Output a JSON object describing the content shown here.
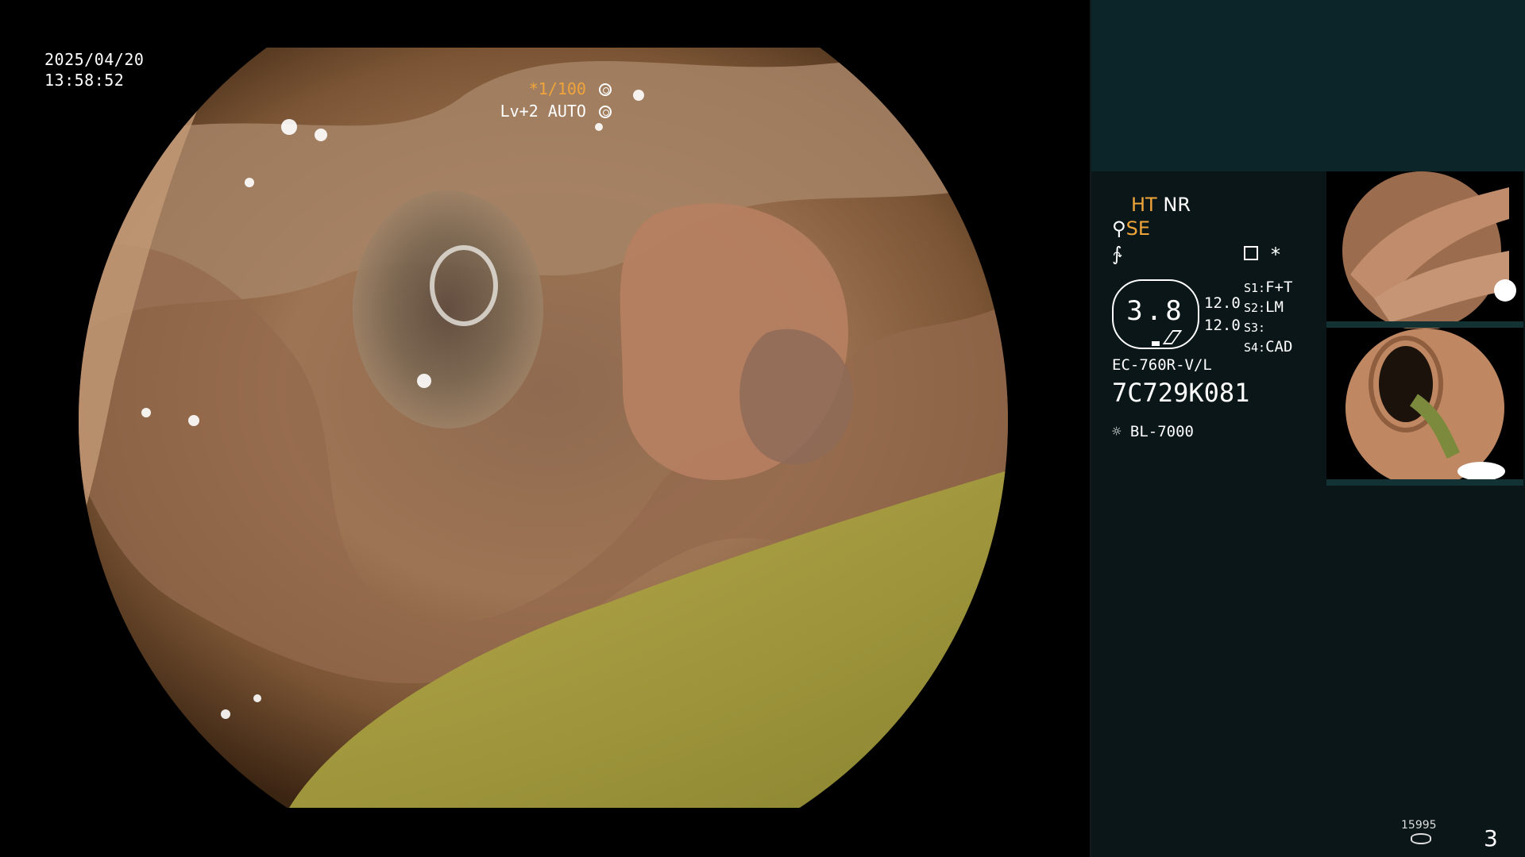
{
  "overlay": {
    "date": "2025/04/20",
    "time": "13:58:52",
    "shutter": "*1/100",
    "level": "Lv+2 AUTO"
  },
  "modes": {
    "ht": "HT",
    "nr": "NR",
    "se": "SE",
    "star": "*"
  },
  "zoom": {
    "value": "3.8",
    "right_values": [
      "12.0",
      "12.0"
    ]
  },
  "scope_settings": [
    {
      "key": "S1:",
      "value": "F+T"
    },
    {
      "key": "S2:",
      "value": "LM"
    },
    {
      "key": "S3:",
      "value": ""
    },
    {
      "key": "S4:",
      "value": "CAD"
    }
  ],
  "device": {
    "model": "EC-760R-V/L",
    "serial": "7C729K081",
    "light_source": "BL-7000"
  },
  "footer": {
    "counter": "15995",
    "page": "3"
  },
  "icons": {
    "shutter_icon": "aperture-icon",
    "level_icon": "gear-icon",
    "light_icon": "light-source-icon",
    "storage_icon": "disk-icon",
    "doc_icon": "document-icon"
  },
  "colors": {
    "accent_orange": "#f0a53a",
    "panel_dark": "#0a1617",
    "panel_top": "#0b2528"
  }
}
